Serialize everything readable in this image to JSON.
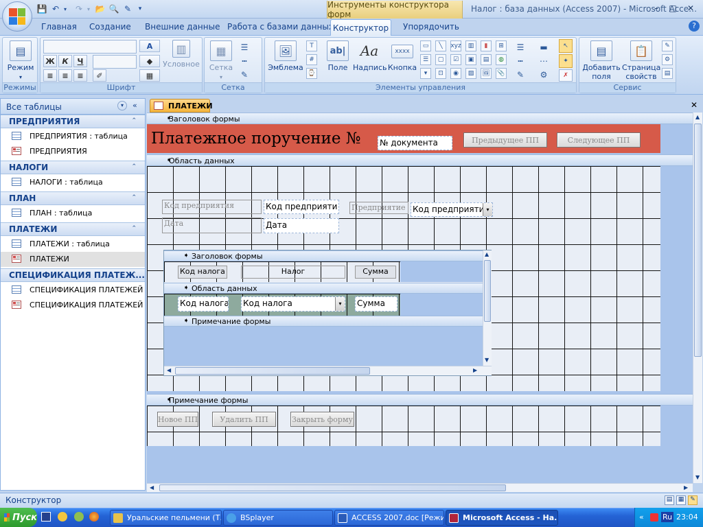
{
  "window": {
    "context_tab": "Инструменты конструктора форм",
    "title": "Налог : база данных (Access 2007) - Microsoft Acce…",
    "controls": {
      "minimize": "–",
      "restore": "□",
      "close": "✕"
    }
  },
  "ribbon": {
    "tabs": [
      "Главная",
      "Создание",
      "Внешние данные",
      "Работа с базами данных",
      "Конструктор",
      "Упорядочить"
    ],
    "active_tab": "Конструктор",
    "groups": {
      "modes": {
        "label": "Режимы",
        "view_button": "Режим"
      },
      "font": {
        "label": "Шрифт",
        "conditional": "Условное"
      },
      "grid": {
        "label": "Сетка",
        "grid_button": "Сетка"
      },
      "controls": {
        "label": "Элементы управления",
        "emblem": "Эмблема",
        "field": "Поле",
        "caption": "Надпись",
        "button": "Кнопка"
      },
      "service": {
        "label": "Сервис",
        "add_fields_1": "Добавить",
        "add_fields_2": "поля",
        "props_1": "Страница",
        "props_2": "свойств"
      }
    }
  },
  "nav": {
    "header": "Все таблицы",
    "groups": [
      {
        "title": "ПРЕДПРИЯТИЯ",
        "items": [
          {
            "label": "ПРЕДПРИЯТИЯ : таблица",
            "type": "table"
          },
          {
            "label": "ПРЕДПРИЯТИЯ",
            "type": "form"
          }
        ]
      },
      {
        "title": "НАЛОГИ",
        "items": [
          {
            "label": "НАЛОГИ : таблица",
            "type": "table"
          }
        ]
      },
      {
        "title": "ПЛАН",
        "items": [
          {
            "label": "ПЛАН : таблица",
            "type": "table"
          }
        ]
      },
      {
        "title": "ПЛАТЕЖИ",
        "items": [
          {
            "label": "ПЛАТЕЖИ : таблица",
            "type": "table"
          },
          {
            "label": "ПЛАТЕЖИ",
            "type": "form",
            "selected": true
          }
        ]
      },
      {
        "title": "СПЕЦИФИКАЦИЯ ПЛАТЕЖ...",
        "items": [
          {
            "label": "СПЕЦИФИКАЦИЯ ПЛАТЕЖЕЙ ...",
            "type": "table"
          },
          {
            "label": "СПЕЦИФИКАЦИЯ ПЛАТЕЖЕЙ ...",
            "type": "form"
          }
        ]
      }
    ]
  },
  "document": {
    "tab_label": "ПЛАТЕЖИ",
    "sections": {
      "header": "Заголовок формы",
      "detail": "Область данных",
      "footer": "Примечание формы"
    },
    "header": {
      "title": "Платежное поручение №",
      "doc_number": "№ документа",
      "prev_button": "Предыдущее ПП",
      "next_button": "Следующее ПП",
      "background": "#d65a49"
    },
    "detail": {
      "company_code_label": "Код предприятия",
      "company_code_value": "Код предприяти",
      "company_label": "Предприятие",
      "company_combo": "Код предприяти",
      "date_label": "Дата",
      "date_value": "Дата"
    },
    "subform": {
      "header_section": "Заголовок формы",
      "detail_section": "Область данных",
      "footer_section": "Примечание формы",
      "col_tax_code": "Код налога",
      "col_tax": "Налог",
      "col_sum": "Сумма",
      "val_tax_code": "Код налога",
      "val_tax_combo": "Код налога",
      "val_sum": "Сумма"
    },
    "footer": {
      "new_button": "Новое ПП",
      "delete_button": "Удалить ПП",
      "close_button": "Закрыть форму"
    }
  },
  "status": {
    "text": "Конструктор"
  },
  "taskbar": {
    "start": "Пуск",
    "buttons": [
      "Уральские пельмени (Т...",
      "BSplayer",
      "ACCESS 2007.doc [Режим...",
      "Microsoft Access - На..."
    ],
    "active_index": 3,
    "language": "Ru",
    "clock": "23:04"
  }
}
